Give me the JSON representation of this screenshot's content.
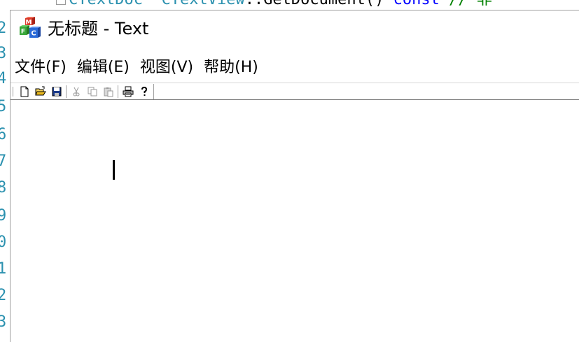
{
  "background_editor": {
    "code_fragment": "CTextDoc* CTextView::GetDocument() const // 非",
    "code_parts": {
      "type1": "CTextDoc",
      "sep1": "* ",
      "type2": "CTextView",
      "rest": "::GetDocument() ",
      "keyword": "const",
      "comment": " // 非"
    },
    "line_numbers": [
      "2",
      "3",
      "4",
      "5",
      "6",
      "7",
      "8",
      "9",
      "0",
      "1",
      "2",
      "3"
    ]
  },
  "window": {
    "title": "无标题 - Text",
    "icon": "mfc-app-icon"
  },
  "menu": {
    "items": [
      {
        "label": "文件(F)"
      },
      {
        "label": "编辑(E)"
      },
      {
        "label": "视图(V)"
      },
      {
        "label": "帮助(H)"
      }
    ]
  },
  "toolbar": {
    "buttons": [
      {
        "name": "new-file-icon",
        "enabled": true
      },
      {
        "name": "open-folder-icon",
        "enabled": true
      },
      {
        "name": "save-icon",
        "enabled": true
      },
      {
        "name": "cut-icon",
        "enabled": false
      },
      {
        "name": "copy-icon",
        "enabled": false
      },
      {
        "name": "paste-icon",
        "enabled": false
      },
      {
        "name": "print-icon",
        "enabled": true
      },
      {
        "name": "help-icon",
        "enabled": true
      }
    ]
  },
  "colors": {
    "line_number": "#2b91af",
    "keyword": "#0000ff",
    "comment": "#008000"
  }
}
